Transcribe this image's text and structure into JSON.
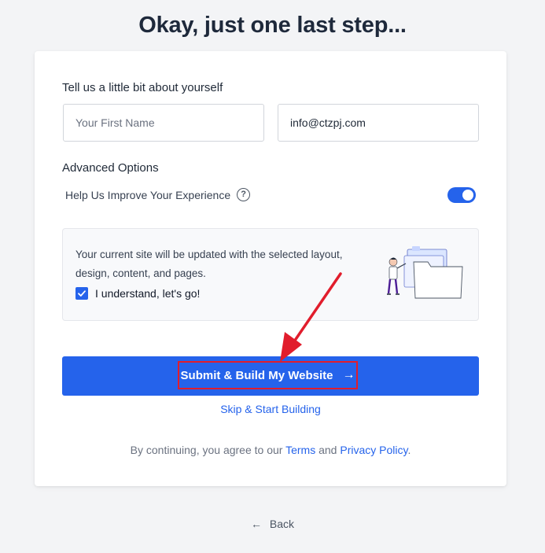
{
  "page": {
    "title": "Okay, just one last step..."
  },
  "form": {
    "about_heading": "Tell us a little bit about yourself",
    "first_name": {
      "placeholder": "Your First Name",
      "value": ""
    },
    "email": {
      "placeholder": "",
      "value": "info@ctzpj.com"
    },
    "advanced_heading": "Advanced Options",
    "improve_label": "Help Us Improve Your Experience",
    "help_icon_glyph": "?",
    "improve_enabled": true
  },
  "notice": {
    "text": "Your current site will be updated with the selected layout, design, content, and pages.",
    "checkbox_label": "I understand, let's go!",
    "checked": true
  },
  "actions": {
    "submit_label": "Submit & Build My Website",
    "submit_arrow": "→",
    "skip_label": "Skip & Start Building",
    "back_label": "Back",
    "back_arrow": "←"
  },
  "legal": {
    "prefix": "By continuing, you agree to our",
    "terms": "Terms",
    "and": "and",
    "privacy": "Privacy Policy",
    "suffix": "."
  },
  "colors": {
    "accent": "#2563eb",
    "highlight_border": "#e11d2c",
    "background": "#f3f4f6"
  }
}
